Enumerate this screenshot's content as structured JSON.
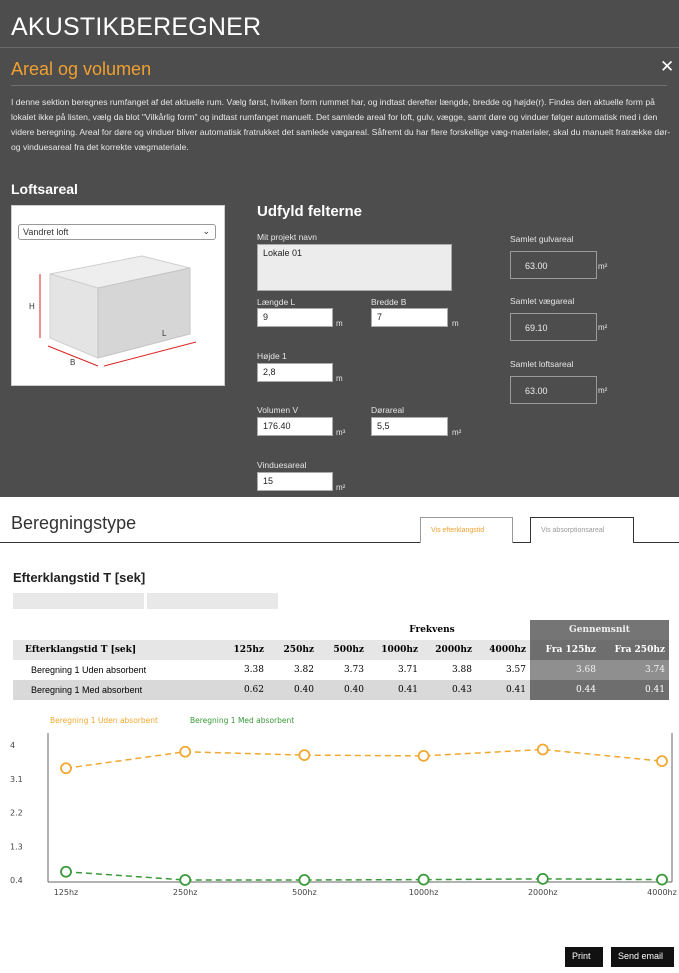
{
  "header": {
    "app_title": "AKUSTIKBEREGNER",
    "section_title": "Areal og volumen",
    "close_icon": "close-icon",
    "intro_text": "I denne sektion beregnes rumfanget af det aktuelle rum. Vælg først, hvilken form rummet har, og indtast derefter længde, bredde og højde(r). Findes den aktuelle form på lokalet ikke på listen, vælg da blot \"Vilkårlig form\" og indtast rumfanget manuelt. Det samlede areal for loft, gulv, vægge, samt døre og vinduer følger automatisk med i den videre beregning. Areal for døre og vinduer bliver automatisk fratrukket det samlede vægareal. Såfremt du har flere forskellige væg-materialer, skal du manuelt fratrække dør- og vinduesareal fra det korrekte vægmateriale."
  },
  "loft": {
    "heading": "Loftsareal",
    "shape_select": "Vandret loft",
    "diagram_labels": {
      "h": "H",
      "b": "B",
      "l": "L"
    }
  },
  "form": {
    "heading": "Udfyld felterne",
    "project_label": "Mit projekt navn",
    "project_value": "Lokale 01",
    "length_label": "Længde L",
    "length_value": "9",
    "width_label": "Bredde B",
    "width_value": "7",
    "height_label": "Højde 1",
    "height_value": "2,8",
    "volume_label": "Volumen V",
    "volume_value": "176.40",
    "door_label": "Dørareal",
    "door_value": "5,5",
    "window_label": "Vinduesareal",
    "window_value": "15",
    "unit_m": "m",
    "unit_m3": "m³",
    "unit_m2": "m²"
  },
  "summary": {
    "floor_label": "Samlet gulvareal",
    "floor_value": "63.00",
    "wall_label": "Samlet vægareal",
    "wall_value": "69.10",
    "ceiling_label": "Samlet loftsareal",
    "ceiling_value": "63.00",
    "unit": "m²"
  },
  "calc": {
    "title": "Beregningstype",
    "tab_eft": "Vis efterklangstid",
    "tab_abs": "Vis absorptionsareal"
  },
  "table": {
    "heading": "Efterklangstid T [sek]",
    "group_freq": "Frekvens",
    "group_avg": "Gennemsnit",
    "col_label": "Efterklangstid T [sek]",
    "freq_cols": [
      "125hz",
      "250hz",
      "500hz",
      "1000hz",
      "2000hz",
      "4000hz"
    ],
    "avg_cols": [
      "Fra 125hz",
      "Fra 250hz"
    ],
    "rows": [
      {
        "label": "Beregning 1 Uden absorbent",
        "values": [
          "3.38",
          "3.82",
          "3.73",
          "3.71",
          "3.88",
          "3.57"
        ],
        "avgs": [
          "3.68",
          "3.74"
        ]
      },
      {
        "label": "Beregning 1 Med absorbent",
        "values": [
          "0.62",
          "0.40",
          "0.40",
          "0.41",
          "0.43",
          "0.41"
        ],
        "avgs": [
          "0.44",
          "0.41"
        ]
      }
    ]
  },
  "chart_data": {
    "type": "line",
    "title": "",
    "xlabel": "",
    "ylabel": "",
    "categories": [
      "125hz",
      "250hz",
      "500hz",
      "1000hz",
      "2000hz",
      "4000hz"
    ],
    "y_ticks": [
      "4",
      "3.1",
      "2.2",
      "1.3",
      "0.4"
    ],
    "ylim": [
      0.4,
      4.0
    ],
    "grid": false,
    "legend_placement": "top-left",
    "series": [
      {
        "name": "Beregning 1 Uden absorbent",
        "values": [
          3.38,
          3.82,
          3.73,
          3.71,
          3.88,
          3.57
        ],
        "color": "#f0a830"
      },
      {
        "name": "Beregning 1 Med absorbent",
        "values": [
          0.62,
          0.4,
          0.4,
          0.41,
          0.43,
          0.41
        ],
        "color": "#3a9a3a"
      }
    ]
  },
  "buttons": {
    "print": "Print",
    "send_email": "Send email"
  },
  "colors": {
    "accent_orange": "#f0a030",
    "dark_panel": "#4d4d4d",
    "green_series": "#3a9a3a"
  }
}
